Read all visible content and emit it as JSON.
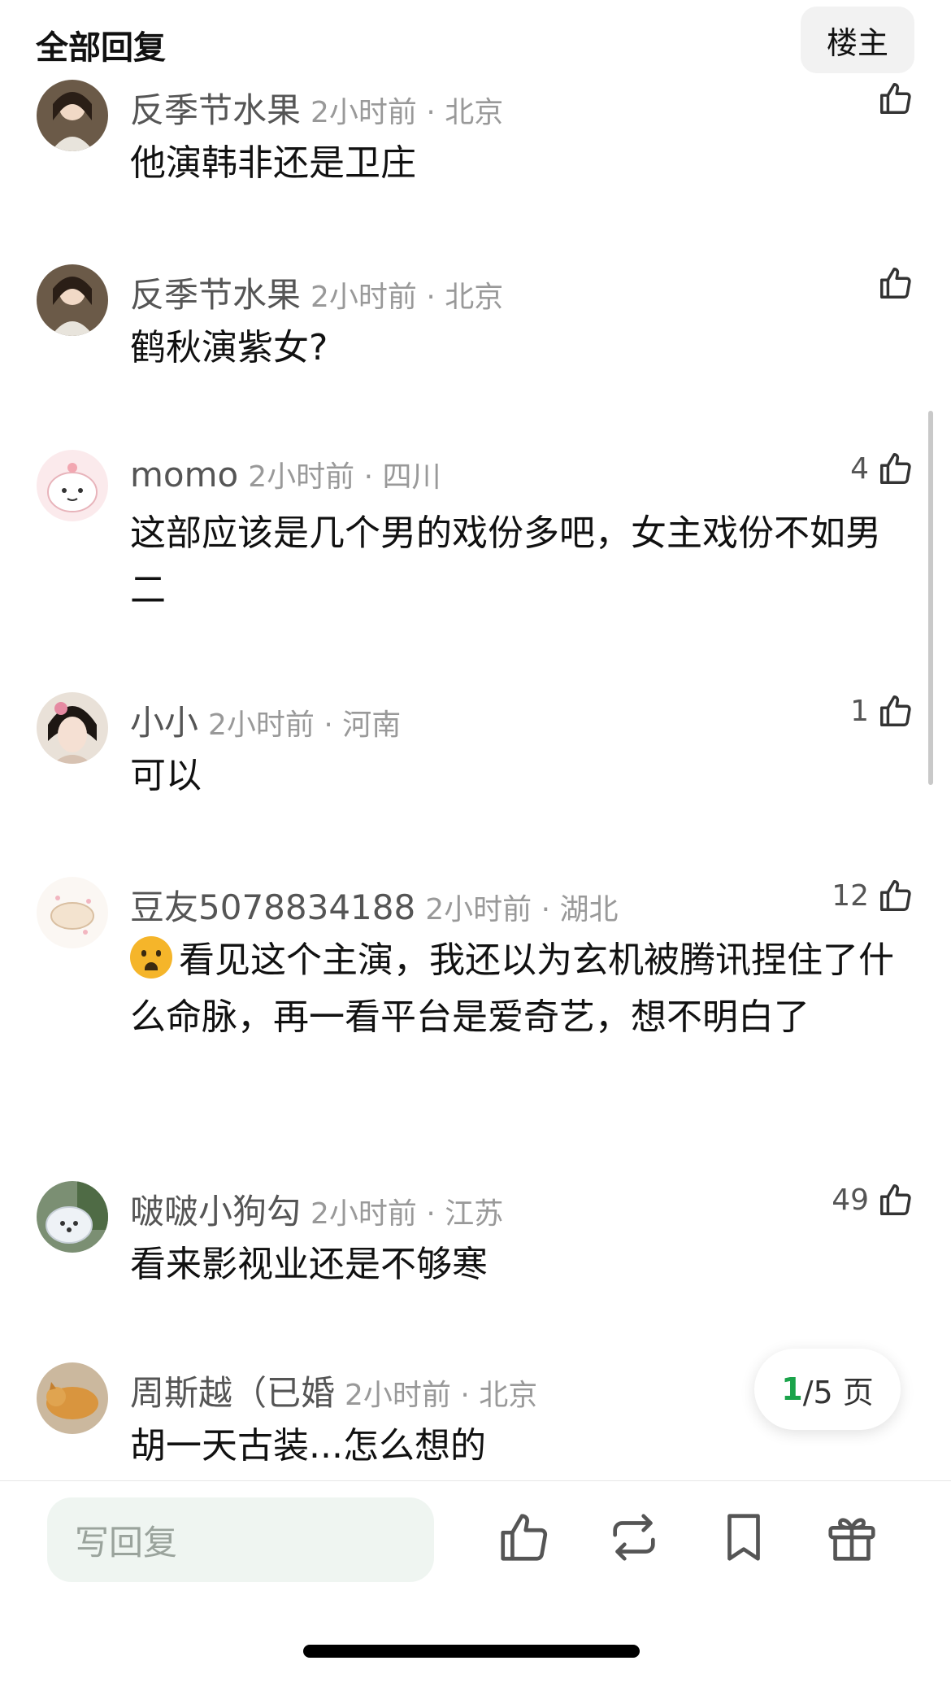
{
  "header": {
    "title": "全部回复",
    "owner_button": "楼主"
  },
  "comments": [
    {
      "name": "反季节水果",
      "time": "2小时前 · 北京",
      "likes": "",
      "text": "他演韩非还是卫庄"
    },
    {
      "name": "反季节水果",
      "time": "2小时前 · 北京",
      "likes": "",
      "text": "鹤秋演紫女?"
    },
    {
      "name": "momo",
      "time": "2小时前 · 四川",
      "likes": "4",
      "text": "这部应该是几个男的戏份多吧，女主戏份不如男二"
    },
    {
      "name": "小小",
      "time": "2小时前 · 河南",
      "likes": "1",
      "text": "可以"
    },
    {
      "name": "豆友5078834188",
      "time": "2小时前 · 湖北",
      "likes": "12",
      "text": "看见这个主演，我还以为玄机被腾讯捏住了什么命脉，再一看平台是爱奇艺，想不明白了"
    },
    {
      "name": "啵啵小狗勾",
      "time": "2小时前 · 江苏",
      "likes": "49",
      "text": "看来影视业还是不够寒"
    },
    {
      "name": "周斯越（已婚",
      "time": "2小时前 · 北京",
      "likes": "",
      "text": "胡一天古装...怎么想的"
    }
  ],
  "pagination": {
    "current": "1",
    "total_suffix": "/5 页"
  },
  "bottom_bar": {
    "reply_placeholder": "写回复"
  },
  "icons": {
    "like": "thumbs-up-icon",
    "repost": "repost-icon",
    "bookmark": "bookmark-icon",
    "gift": "gift-icon",
    "emoji": "worried-face-emoji"
  },
  "colors": {
    "accent_green": "#1aa34a",
    "input_bg": "#eff5f1",
    "meta_gray": "#999999"
  }
}
